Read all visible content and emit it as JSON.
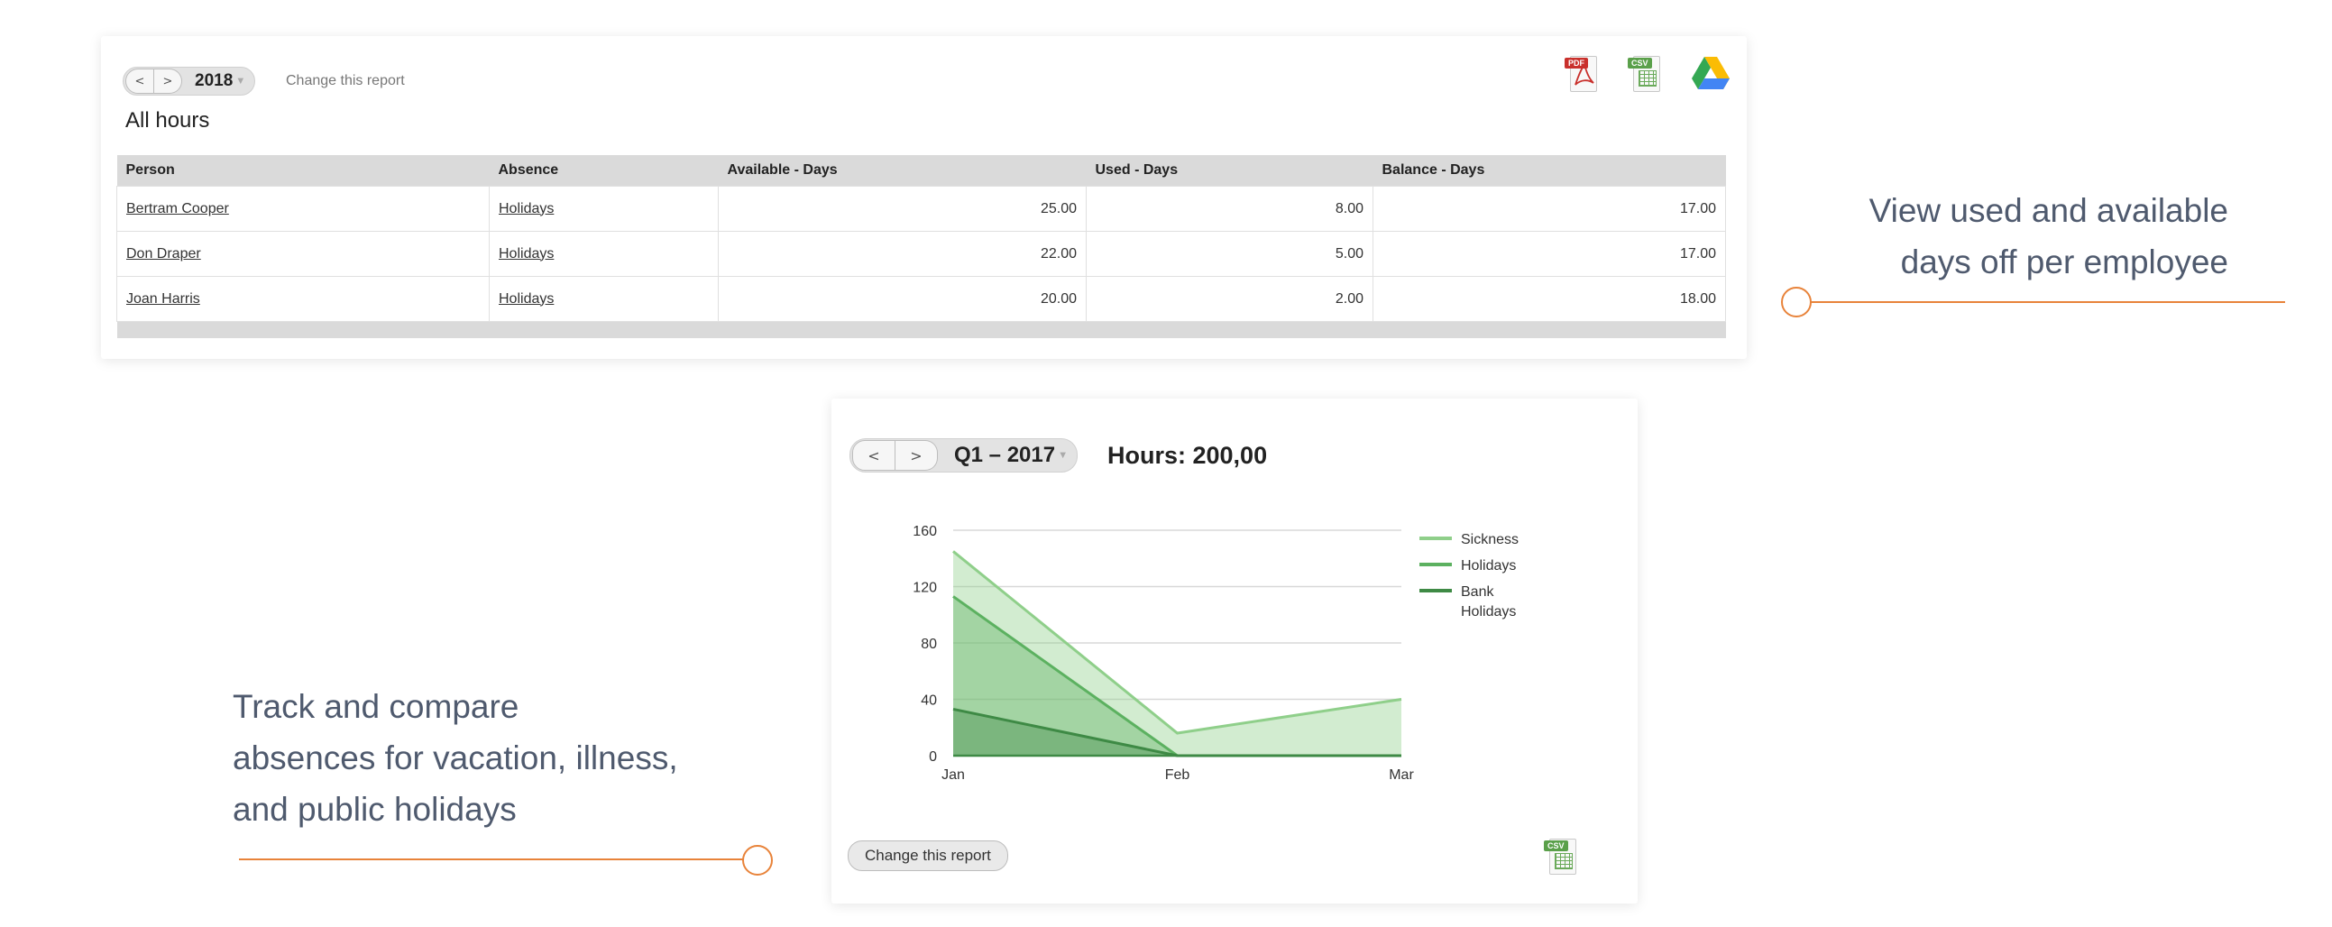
{
  "report": {
    "nav_prev": "<",
    "nav_next": ">",
    "period": "2018",
    "change_link": "Change this report",
    "title": "All hours",
    "export": {
      "pdf_tag": "PDF",
      "csv_tag": "CSV",
      "drive_icon": "google-drive-icon"
    },
    "columns": [
      "Person",
      "Absence",
      "Available - Days",
      "Used - Days",
      "Balance - Days"
    ],
    "rows": [
      {
        "person": "Bertram Cooper",
        "absence": "Holidays",
        "available": "25.00",
        "used": "8.00",
        "balance": "17.00"
      },
      {
        "person": "Don Draper",
        "absence": "Holidays",
        "available": "22.00",
        "used": "5.00",
        "balance": "17.00"
      },
      {
        "person": "Joan Harris",
        "absence": "Holidays",
        "available": "20.00",
        "used": "2.00",
        "balance": "18.00"
      }
    ]
  },
  "chart_panel": {
    "nav_prev": "<",
    "nav_next": ">",
    "period": "Q1 – 2017",
    "heading": "Hours: 200,00",
    "change_button": "Change this report",
    "csv_tag": "CSV"
  },
  "chart_data": {
    "type": "area",
    "categories": [
      "Jan",
      "Feb",
      "Mar"
    ],
    "series": [
      {
        "name": "Sickness",
        "values": [
          145,
          16,
          40
        ],
        "color": "#8fcf8a"
      },
      {
        "name": "Holidays",
        "values": [
          113,
          0,
          0
        ],
        "color": "#5cb160"
      },
      {
        "name": "Bank Holidays",
        "values": [
          33,
          0,
          0
        ],
        "color": "#3e8a45"
      }
    ],
    "yticks": [
      "0",
      "40",
      "80",
      "120",
      "160"
    ],
    "ylim": [
      0,
      160
    ],
    "grid": true,
    "legend_position": "right"
  },
  "annotations": {
    "right": [
      "View used and available",
      "days off per employee"
    ],
    "left": [
      "Track and compare",
      "absences for vacation, illness,",
      "and public holidays"
    ]
  },
  "colors": {
    "accent": "#e8833a",
    "callout_text": "#4f5a6e"
  }
}
